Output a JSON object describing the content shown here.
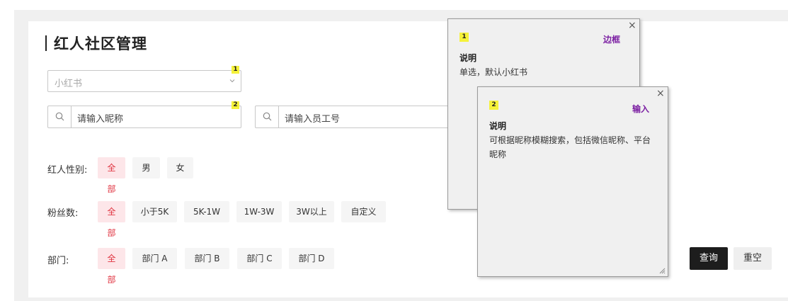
{
  "page": {
    "title": "红人社区管理"
  },
  "platform_select": {
    "value": "小红书",
    "badge": "1"
  },
  "nickname_search": {
    "placeholder": "请输入昵称",
    "badge": "2"
  },
  "employee_search": {
    "placeholder": "请输入员工号"
  },
  "filters": {
    "gender": {
      "label": "红人性别:",
      "options": [
        "全部",
        "男",
        "女"
      ],
      "selected": "全部"
    },
    "fans": {
      "label": "粉丝数:",
      "options": [
        "全部",
        "小于5K",
        "5K-1W",
        "1W-3W",
        "3W以上",
        "自定义"
      ],
      "selected": "全部"
    },
    "department": {
      "label": "部门:",
      "options": [
        "全部",
        "部门 A",
        "部门 B",
        "部门 C",
        "部门 D"
      ],
      "selected": "全部"
    }
  },
  "actions": {
    "query": "查询",
    "reset": "重空"
  },
  "notes": [
    {
      "number": "1",
      "type": "边框",
      "heading": "说明",
      "body": "单选，默认小红书",
      "close": "×"
    },
    {
      "number": "2",
      "type": "输入",
      "heading": "说明",
      "body": "可根据昵称模糊搜索，包括微信昵称、平台昵称",
      "close": "×"
    }
  ],
  "colors": {
    "accent": "#e0323f",
    "accent_bg": "#fde6e9",
    "note_type": "#7b1fa2",
    "badge": "#f5f23a",
    "primary_button": "#1d1d1d"
  },
  "icons": {
    "select_arrow": "chevron-down-icon",
    "search": "search-icon",
    "close": "close-icon",
    "resize": "resize-grip-icon"
  }
}
